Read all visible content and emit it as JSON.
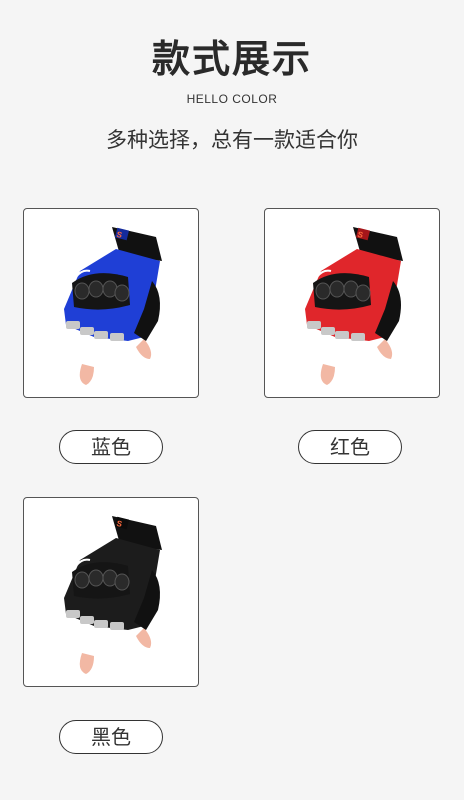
{
  "header": {
    "title": "款式展示",
    "subtitle": "HELLO COLOR",
    "tagline": "多种选择，总有一款适合你"
  },
  "products": [
    {
      "label": "蓝色",
      "color": "#1f3fd6",
      "color_dark": "#142b9c",
      "cuff_logo": "S"
    },
    {
      "label": "红色",
      "color": "#e0262b",
      "color_dark": "#a5161a",
      "cuff_logo": "S"
    },
    {
      "label": "黑色",
      "color": "#1c1c1c",
      "color_dark": "#0b0b0b",
      "cuff_logo": "S"
    }
  ],
  "glove": {
    "trim": "#111111",
    "knuckle": "#151515",
    "reflect": "#c8c8c8",
    "skin": "#f2b8a4"
  }
}
